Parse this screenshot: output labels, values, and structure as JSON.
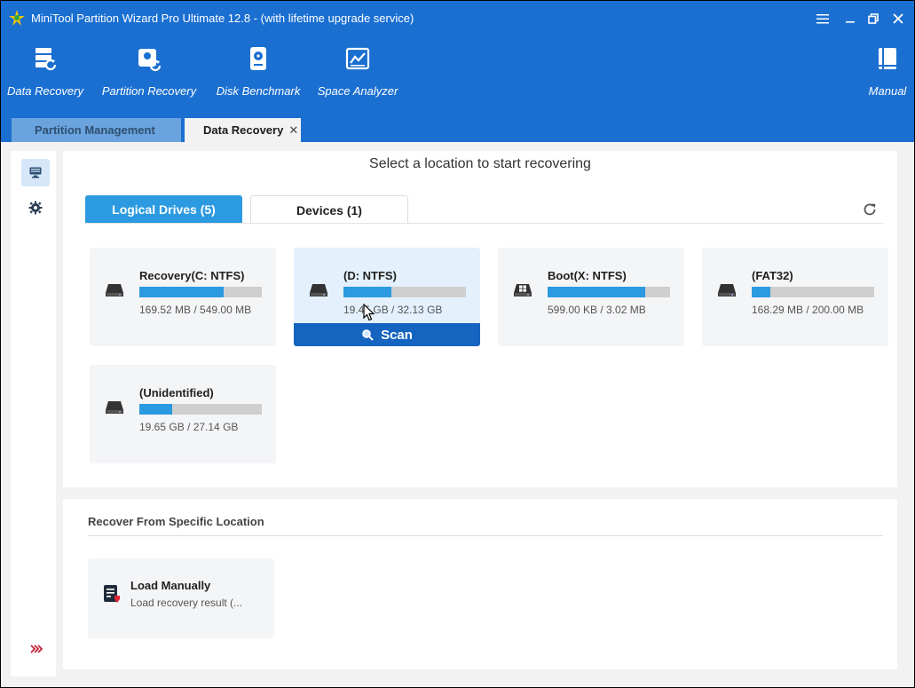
{
  "window": {
    "title": "MiniTool Partition Wizard Pro Ultimate 12.8 - (with lifetime upgrade service)"
  },
  "toolbar": {
    "data_recovery": "Data Recovery",
    "partition_recovery": "Partition Recovery",
    "disk_benchmark": "Disk Benchmark",
    "space_analyzer": "Space Analyzer",
    "manual": "Manual"
  },
  "tabs": {
    "partition_management": "Partition Management",
    "data_recovery": "Data Recovery",
    "close_glyph": "✕"
  },
  "main": {
    "heading": "Select a location to start recovering",
    "logical_tab": "Logical Drives (5)",
    "devices_tab": "Devices (1)",
    "scan_label": "Scan"
  },
  "drives": [
    {
      "name": "Recovery(C: NTFS)",
      "size": "169.52 MB / 549.00 MB",
      "used_pct": 69,
      "icon": "drive-icon"
    },
    {
      "name": "(D: NTFS)",
      "size": "19.45 GB / 32.13 GB",
      "used_pct": 39,
      "icon": "drive-icon"
    },
    {
      "name": "Boot(X: NTFS)",
      "size": "599.00 KB / 3.02 MB",
      "used_pct": 80,
      "icon": "windows-drive-icon"
    },
    {
      "name": "(FAT32)",
      "size": "168.29 MB / 200.00 MB",
      "used_pct": 15,
      "icon": "drive-icon"
    },
    {
      "name": "(Unidentified)",
      "size": "19.65 GB / 27.14 GB",
      "used_pct": 27,
      "icon": "drive-icon"
    }
  ],
  "specific": {
    "heading": "Recover From Specific Location",
    "load_title": "Load Manually",
    "load_subtitle": "Load recovery result (..."
  },
  "colors": {
    "header_blue": "#1a6fd1",
    "accent_blue": "#2c9ae0",
    "scan_blue": "#1565c0",
    "close_red": "#e0263a"
  }
}
